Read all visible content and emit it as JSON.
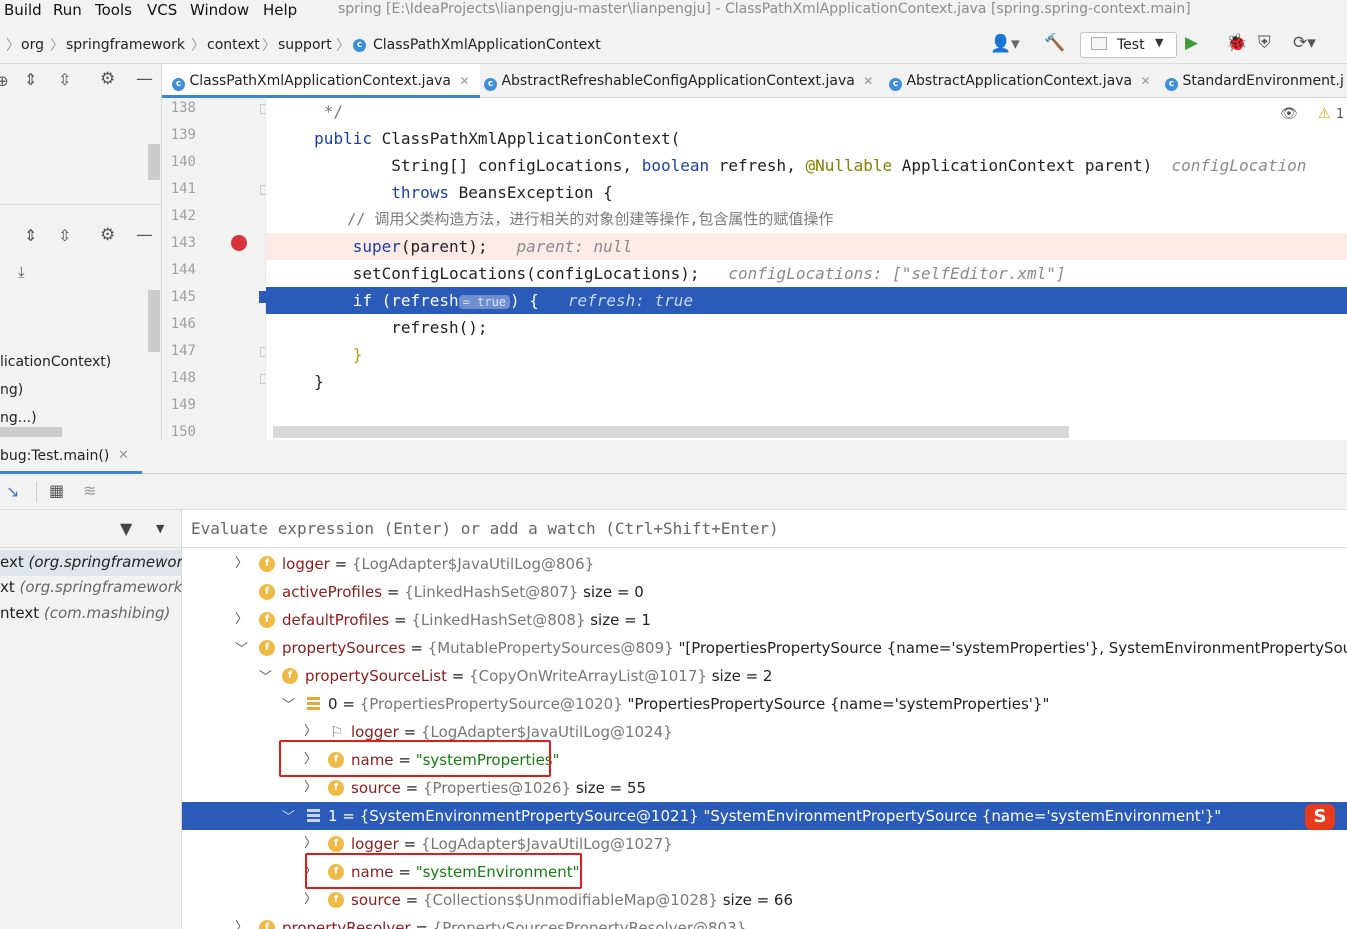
{
  "menu": [
    "Build",
    "Run",
    "Tools",
    "VCS",
    "Window",
    "Help"
  ],
  "window_title": "spring [E:\\IdeaProjects\\lianpengju-master\\lianpengju] - ClassPathXmlApplicationContext.java [spring.spring-context.main]",
  "breadcrumb": [
    "org",
    "springframework",
    "context",
    "support",
    "ClassPathXmlApplicationContext"
  ],
  "run_config": "Test",
  "tabs": [
    "ClassPathXmlApplicationContext.java",
    "AbstractRefreshableConfigApplicationContext.java",
    "AbstractApplicationContext.java",
    "StandardEnvironment.j"
  ],
  "warning_count": "1",
  "left_panel": [
    "licationContext)",
    "ng)",
    "ng...)"
  ],
  "line_numbers": [
    "138",
    "139",
    "140",
    "141",
    "142",
    "143",
    "144",
    "145",
    "146",
    "147",
    "148",
    "149",
    "150"
  ],
  "code": {
    "l138": "*/",
    "l139_kw": "public",
    "l139_rest": " ClassPathXmlApplicationContext(",
    "l140_a": "String[] configLocations, ",
    "l140_kw": "boolean",
    "l140_b": " refresh, ",
    "l140_annot": "@Nullable",
    "l140_c": " ApplicationContext parent)",
    "l140_hint": "configLocation",
    "l141_kw": "throws",
    "l141_rest": " BeansException {",
    "l142": "// 调用父类构造方法，进行相关的对象创建等操作,包含属性的赋值操作",
    "l143_kw": "super",
    "l143_rest": "(parent);",
    "l143_hint": "parent: null",
    "l144": "setConfigLocations(configLocations);",
    "l144_hint": "configLocations: [\"selfEditor.xml\"]",
    "l145_a": "if (refresh",
    "l145_inline": "= true",
    "l145_b": ") {",
    "l145_hint": "refresh: true",
    "l146": "refresh();",
    "l147": "}",
    "l148": "}"
  },
  "debug_tab": "bug:Test.main()",
  "eval_placeholder": "Evaluate expression (Enter) or add a watch (Ctrl+Shift+Enter)",
  "frames": [
    {
      "a": "ext ",
      "b": "(org.springframework."
    },
    {
      "a": "xt ",
      "b": "(org.springframework.co"
    },
    {
      "a": "ntext ",
      "b": "(com.mashibing)"
    }
  ],
  "vars": [
    {
      "name": "logger",
      "ref": "{LogAdapter$JavaUtilLog@806}",
      "extra": ""
    },
    {
      "name": "activeProfiles",
      "ref": "{LinkedHashSet@807}",
      "extra": "size = 0"
    },
    {
      "name": "defaultProfiles",
      "ref": "{LinkedHashSet@808}",
      "extra": "size = 1"
    },
    {
      "name": "propertySources",
      "ref": "{MutablePropertySources@809}",
      "extra": "\"[PropertiesPropertySource {name='systemProperties'}, SystemEnvironmentPropertySource {name='s"
    },
    {
      "name": "propertySourceList",
      "ref": "{CopyOnWriteArrayList@1017}",
      "extra": "size = 2"
    },
    {
      "name": "0",
      "ref": "{PropertiesPropertySource@1020}",
      "extra": "\"PropertiesPropertySource {name='systemProperties'}\""
    },
    {
      "name": "logger",
      "ref": "{LogAdapter$JavaUtilLog@1024}",
      "extra": ""
    },
    {
      "name": "name",
      "ref": "",
      "extra": "\"systemProperties\""
    },
    {
      "name": "source",
      "ref": "{Properties@1026}",
      "extra": "size = 55"
    },
    {
      "name": "1",
      "ref": "{SystemEnvironmentPropertySource@1021}",
      "extra": "\"SystemEnvironmentPropertySource {name='systemEnvironment'}\""
    },
    {
      "name": "logger",
      "ref": "{LogAdapter$JavaUtilLog@1027}",
      "extra": ""
    },
    {
      "name": "name",
      "ref": "",
      "extra": "\"systemEnvironment\""
    },
    {
      "name": "source",
      "ref": "{Collections$UnmodifiableMap@1028}",
      "extra": "size = 66"
    },
    {
      "name": "propertyResolver",
      "ref": "{PropertySourcesPropertyResolver@803}",
      "extra": ""
    }
  ],
  "eq": "="
}
